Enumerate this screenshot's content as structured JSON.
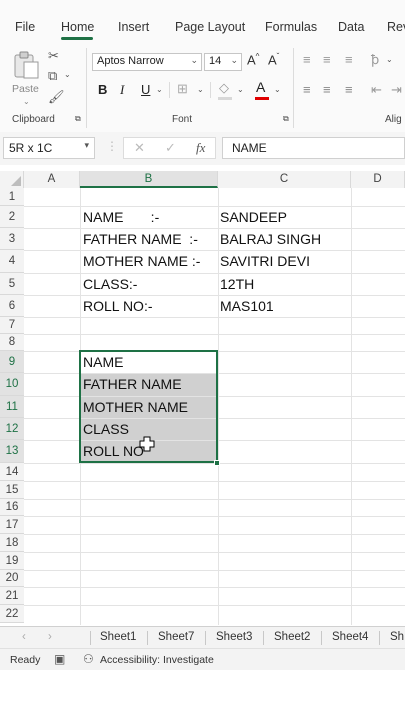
{
  "ribbon_tabs": [
    "File",
    "Home",
    "Insert",
    "Page Layout",
    "Formulas",
    "Data",
    "Rev"
  ],
  "clipboard": {
    "paste_label": "Paste",
    "group_label": "Clipboard"
  },
  "font": {
    "name": "Aptos Narrow",
    "size": "14",
    "group_label": "Font",
    "grow": "A",
    "shrink": "A",
    "bold": "B",
    "italic": "I",
    "underline": "U"
  },
  "alignment": {
    "group_label": "Alig"
  },
  "formula_bar": {
    "name_box": "5R x 1C",
    "fx": "fx",
    "content": "NAME"
  },
  "columns": [
    "A",
    "B",
    "C",
    "D"
  ],
  "rows": [
    "1",
    "2",
    "3",
    "4",
    "5",
    "6",
    "7",
    "8",
    "9",
    "10",
    "11",
    "12",
    "13",
    "14",
    "15",
    "16",
    "17",
    "18",
    "19",
    "20",
    "21",
    "22"
  ],
  "cells": {
    "b2": "NAME       :-",
    "c2": "SANDEEP",
    "b3": "FATHER NAME  :-",
    "c3": "BALRAJ SINGH",
    "b4": "MOTHER NAME :-",
    "c4": "SAVITRI DEVI",
    "b5": "CLASS:-",
    "c5": "12TH",
    "b6": "ROLL NO:-",
    "c6": "MAS101",
    "b9": "NAME",
    "b10": "FATHER NAME",
    "b11": "MOTHER NAME",
    "b12": "CLASS",
    "b13": "ROLL NO"
  },
  "sheets": [
    "Sheet1",
    "Sheet7",
    "Sheet3",
    "Sheet2",
    "Sheet4",
    "Sh"
  ],
  "status": {
    "ready": "Ready",
    "accessibility": "Accessibility: Investigate"
  },
  "colors": {
    "accent": "#1e7145",
    "selection": "#d0d0d0",
    "grid": "#e3e3e3"
  }
}
